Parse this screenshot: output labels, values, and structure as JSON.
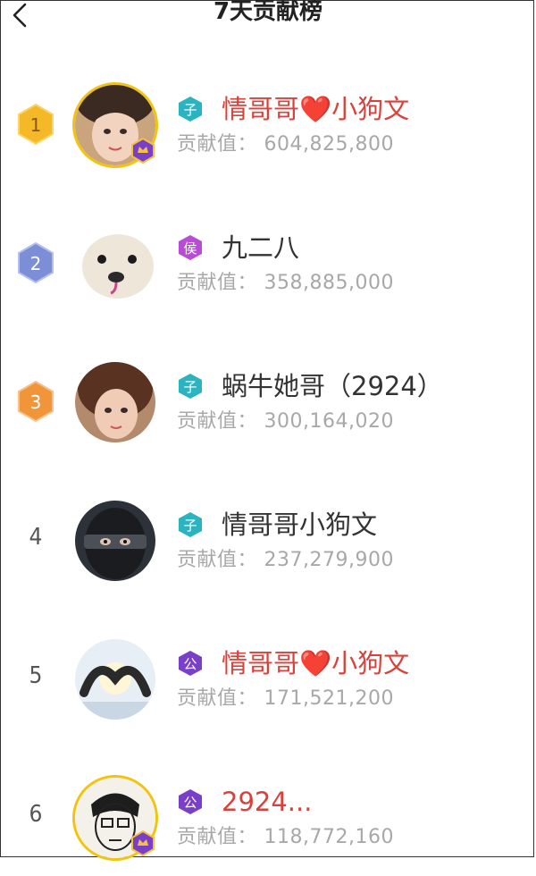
{
  "header": {
    "title": "7天贡献榜"
  },
  "score_label": "贡献值：",
  "rows": [
    {
      "rank": "1",
      "level_char": "子",
      "name": "情哥哥❤️小狗文",
      "score": "604,825,800",
      "level_color": "#2bb3c0"
    },
    {
      "rank": "2",
      "level_char": "侯",
      "name": "九二八",
      "score": "358,885,000",
      "level_color": "#b84cd6"
    },
    {
      "rank": "3",
      "level_char": "子",
      "name": "蜗牛她哥（2924）",
      "score": "300,164,020",
      "level_color": "#2bb3c0"
    },
    {
      "rank": "4",
      "level_char": "子",
      "name": "情哥哥小狗文",
      "score": "237,279,900",
      "level_color": "#2bb3c0"
    },
    {
      "rank": "5",
      "level_char": "公",
      "name": "情哥哥❤️小狗文",
      "score": "171,521,200",
      "level_color": "#7a3fc9"
    },
    {
      "rank": "6",
      "level_char": "公",
      "name": "2924...",
      "score": "118,772,160",
      "level_color": "#7a3fc9"
    }
  ],
  "colors": {
    "gold": "#f5b829",
    "silver": "#7c8ed6",
    "bronze": "#f0953a",
    "name_red": "#d9423a"
  }
}
